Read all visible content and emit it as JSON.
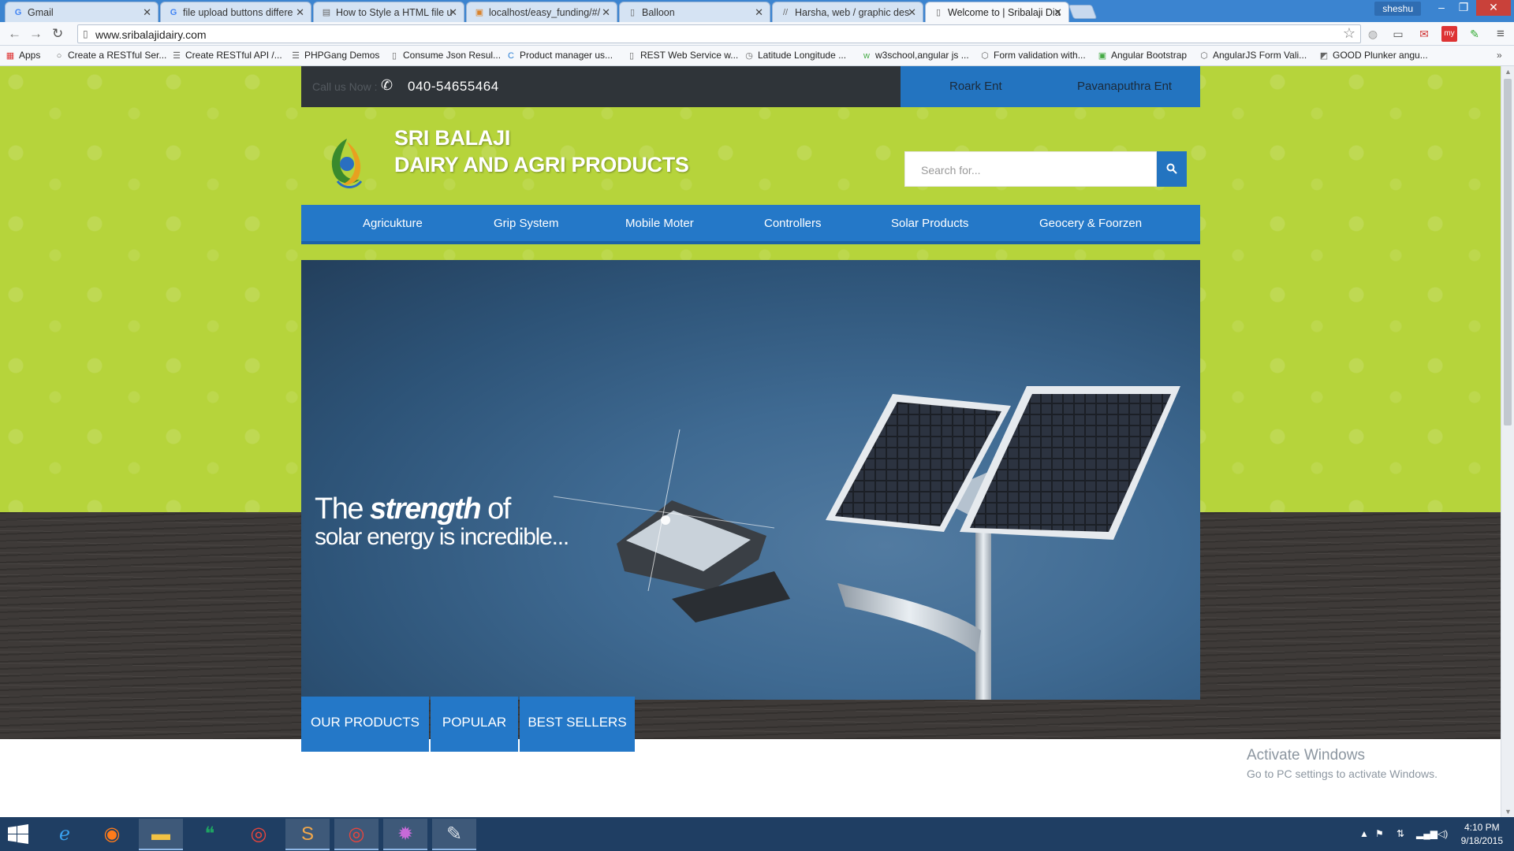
{
  "browser": {
    "tabs": [
      {
        "title": "Gmail",
        "icon": "google-icon"
      },
      {
        "title": "file upload buttons differe",
        "icon": "google-icon"
      },
      {
        "title": "How to Style a HTML file u",
        "icon": "page-icon"
      },
      {
        "title": "localhost/easy_funding/#/",
        "icon": "page-icon"
      },
      {
        "title": "Balloon",
        "icon": "page-icon"
      },
      {
        "title": "Harsha, web / graphic des",
        "icon": "page-icon"
      },
      {
        "title": "Welcome to | Sribalaji Dia",
        "icon": "page-icon"
      }
    ],
    "user": "sheshu",
    "url": "www.sribalajidairy.com",
    "bookmarks": [
      {
        "label": "Apps",
        "icon": "apps-grid-icon"
      },
      {
        "label": "Create a RESTful Ser...",
        "icon": "page-icon"
      },
      {
        "label": "Create RESTful API /...",
        "icon": "page-icon"
      },
      {
        "label": "PHPGang Demos",
        "icon": "page-icon"
      },
      {
        "label": "Consume Json Resul...",
        "icon": "page-icon"
      },
      {
        "label": "Product manager us...",
        "icon": "page-icon"
      },
      {
        "label": "REST Web Service w...",
        "icon": "page-icon"
      },
      {
        "label": "Latitude Longitude ...",
        "icon": "page-icon"
      },
      {
        "label": "w3school,angular js ...",
        "icon": "page-icon"
      },
      {
        "label": "Form validation with...",
        "icon": "page-icon"
      },
      {
        "label": "Angular Bootstrap",
        "icon": "page-icon"
      },
      {
        "label": "AngularJS Form Vali...",
        "icon": "page-icon"
      },
      {
        "label": "GOOD Plunker angu...",
        "icon": "page-icon"
      }
    ]
  },
  "site": {
    "topbar": {
      "call_label": "Call us Now :",
      "phone": "040-54655464",
      "links": [
        "Roark Ent",
        "Pavanaputhra Ent"
      ]
    },
    "brand": {
      "line1": "SRI BALAJI",
      "line2": "DAIRY AND AGRI PRODUCTS"
    },
    "search": {
      "placeholder": "Search for..."
    },
    "nav": [
      "Agricukture",
      "Grip System",
      "Mobile Moter",
      "Controllers",
      "Solar Products",
      "Geocery & Foorzen"
    ],
    "hero": {
      "tag_prefix": "The",
      "tag_emphasis": "strength",
      "tag_suffix": "of",
      "tag_line2": "solar energy is incredible..."
    },
    "product_tabs": [
      "OUR PRODUCTS",
      "POPULAR",
      "BEST SELLERS"
    ],
    "colors": {
      "green": "#b6d43b",
      "blue": "#2478c8",
      "dark": "#2f3439"
    }
  },
  "windows": {
    "watermark_line1": "Activate Windows",
    "watermark_line2": "Go to PC settings to activate Windows.",
    "clock_time": "4:10 PM",
    "clock_date": "9/18/2015",
    "taskbar_apps": [
      "internet-explorer-icon",
      "firefox-icon",
      "file-explorer-icon",
      "hangouts-icon",
      "chrome-icon",
      "sublime-text-icon",
      "chrome-icon",
      "java-ee-icon",
      "paint-icon"
    ]
  }
}
